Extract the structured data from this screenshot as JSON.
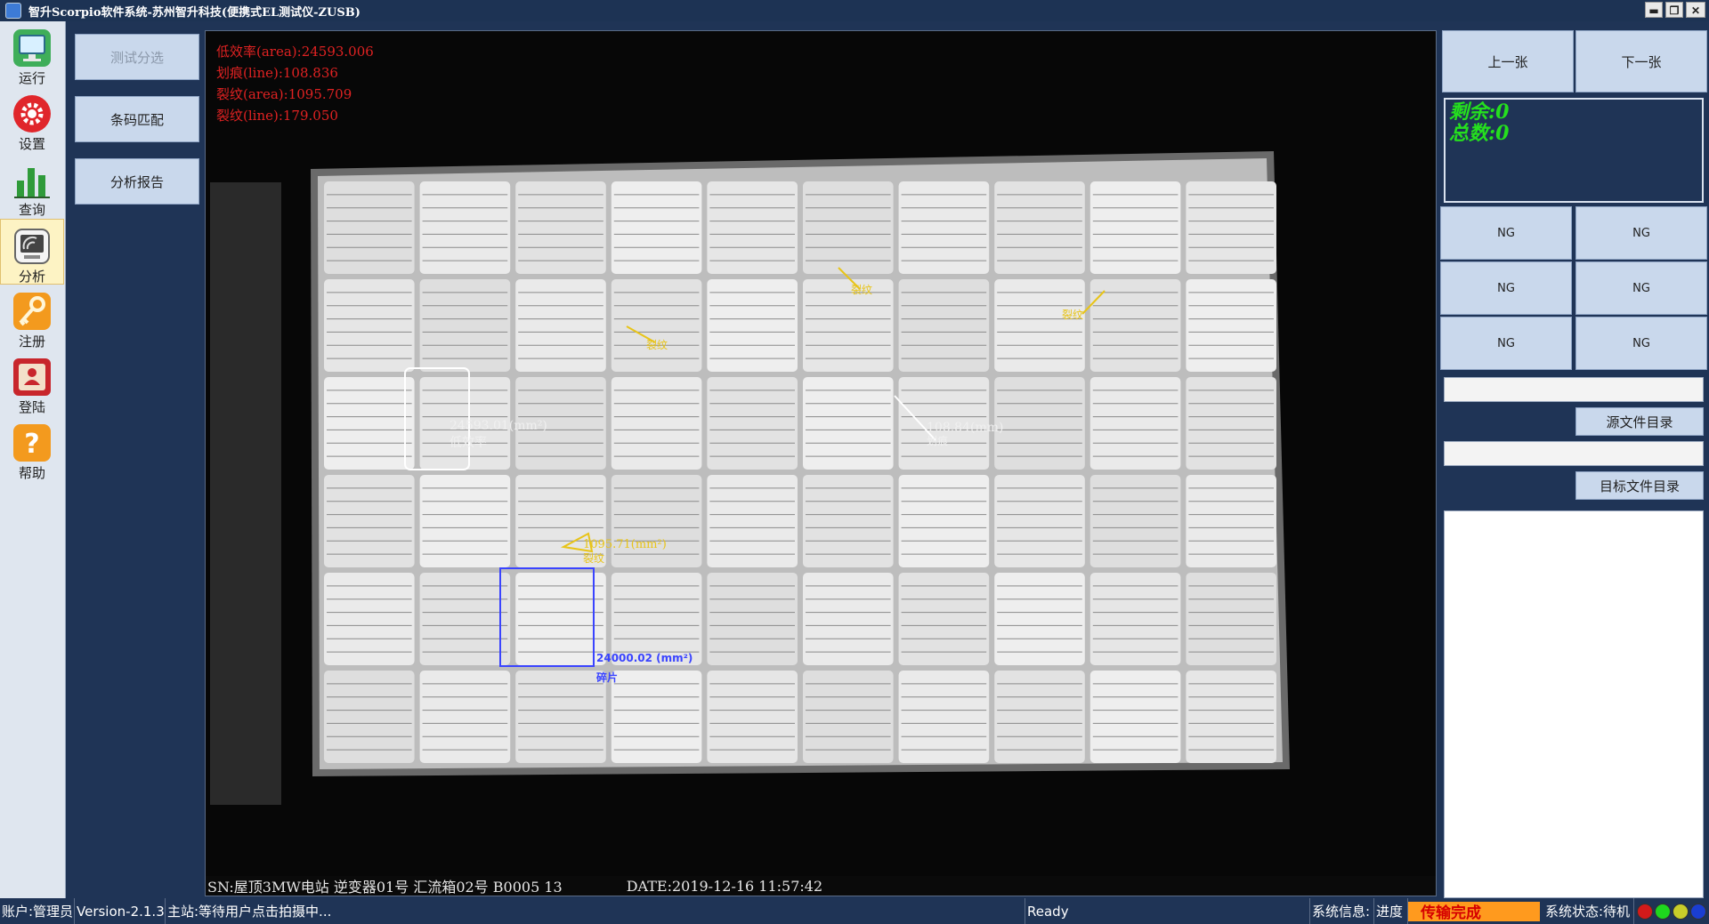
{
  "window": {
    "title": "智升Scorpio软件系统-苏州智升科技(便携式EL测试仪-ZUSB)",
    "minimize": "▬",
    "maximize": "❐",
    "close": "✕"
  },
  "leftnav": {
    "items": [
      {
        "label": "运行",
        "icon": "monitor-icon"
      },
      {
        "label": "设置",
        "icon": "gear-icon"
      },
      {
        "label": "查询",
        "icon": "bar-chart-icon"
      },
      {
        "label": "分析",
        "icon": "analysis-icon"
      },
      {
        "label": "注册",
        "icon": "key-icon"
      },
      {
        "label": "登陆",
        "icon": "login-icon"
      },
      {
        "label": "帮助",
        "icon": "help-icon"
      }
    ],
    "active": "分析"
  },
  "functions": {
    "test_sort": "测试分选",
    "barcode_match": "条码匹配",
    "analysis_report": "分析报告"
  },
  "viewer": {
    "stats": [
      "低效率(area):24593.006",
      "划痕(line):108.836",
      "裂纹(area):1095.709",
      "裂纹(line):179.050"
    ],
    "defects": {
      "low_eff_value": "24593.01(mm²)",
      "low_eff_label": "低效率",
      "line_value": "108.84(mm)",
      "line_label": "划痕",
      "broken_value": "24000.02 (mm²)",
      "broken_label": "碎片",
      "crack_area_value": "1095.71(mm²)",
      "crack_area_label": "裂纹",
      "crack_line_1": "裂纹",
      "crack_line_2": "裂纹",
      "crack_line_3": "裂纹"
    },
    "sn": "SN:屋顶3MW电站 逆变器01号 汇流箱02号 B0005 13",
    "date": "DATE:2019-12-16 11:57:42"
  },
  "right": {
    "prev": "上一张",
    "next": "下一张",
    "remaining": "剩余:0",
    "total": "总数:0",
    "ng_cells": [
      "NG",
      "NG",
      "NG",
      "NG",
      "NG",
      "NG"
    ],
    "source_dir": "源文件目录",
    "target_dir": "目标文件目录",
    "source_path": "",
    "target_path": ""
  },
  "status": {
    "account": "账户:管理员",
    "version": "Version-2.1.3",
    "main": "主站:等待用户点击拍摄中...",
    "ready": "Ready",
    "sysinfo": "系统信息:",
    "progress_label": "进度",
    "progress": "传输完成",
    "sysstate": "系统状态:待机"
  },
  "colors": {
    "stat_text": "#e02222",
    "crack": "#e8c418",
    "broken": "#3a44ff",
    "low_eff": "#ffffff",
    "counter_green": "#25e01e"
  }
}
